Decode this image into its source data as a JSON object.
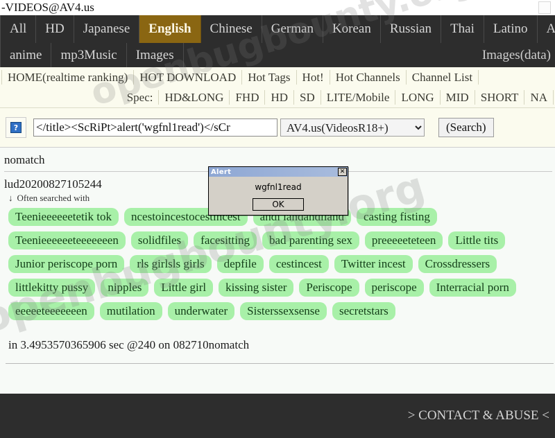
{
  "window": {
    "title": "-VIDEOS@AV4.us"
  },
  "top_nav": {
    "languages": [
      "All",
      "HD",
      "Japanese",
      "English",
      "Chinese",
      "German",
      "Korean",
      "Russian",
      "Thai",
      "Latino",
      "Arab"
    ],
    "active_language": "English",
    "media": [
      "anime",
      "mp3Music",
      "Images"
    ],
    "images_data_label": "Images(data)"
  },
  "sub_nav": {
    "links": [
      "HOME(realtime ranking)",
      "HOT DOWNLOAD",
      "Hot Tags",
      "Hot!",
      "Hot Channels",
      "Channel List"
    ],
    "spec_label": "Spec:",
    "spec_items": [
      "HD&LONG",
      "FHD",
      "HD",
      "SD",
      "LITE/Mobile",
      "LONG",
      "MID",
      "SHORT",
      "NA"
    ]
  },
  "search": {
    "query_value": "</title><ScRiPt>alert('wgfnl1read')</sCr",
    "placeholder": "",
    "site_selected": "AV4.us(VideosR18+)",
    "site_options": [
      "AV4.us(VideosR18+)"
    ],
    "button_label": "(Search)",
    "thumb_icon": "broken-image-icon",
    "thumb_glyph": "?"
  },
  "results": {
    "status": "nomatch",
    "id": "lud20200827105244",
    "often_searched_arrow": "↓",
    "often_searched_label": "Often searched with",
    "tags": [
      "Teenieeeeeetetik tok",
      "ncestoincestocestincest",
      "andi landandiland",
      "casting fisting",
      "Teenieeeeeeteeeeeeen",
      "solidfiles",
      "facesitting",
      "bad parenting sex",
      "preeeeeteteen",
      "Little tits",
      "Junior periscope porn",
      "rls girlsls girls",
      "depfile",
      "cestincest",
      "Twitter incest",
      "Crossdressers",
      "littlekitty pussy",
      "nipples",
      "Little girl",
      "kissing sister",
      "Periscope",
      "periscope",
      "Interracial porn",
      "eeeeeteeeeeeen",
      "mutilation",
      "underwater",
      "Sisterssexsense",
      "secretstars"
    ],
    "timing": "in 3.4953570365906 sec @240 on 082710nomatch"
  },
  "footer": {
    "contact_label": "> CONTACT & ABUSE <"
  },
  "alert_dialog": {
    "title": "Alert",
    "message": "wgfnl1read",
    "ok_label": "OK",
    "close_label": "✕"
  },
  "watermark": {
    "text": "openbugbounty.org"
  },
  "colors": {
    "nav_dark": "#2d2d2d",
    "nav_active": "#8a6612",
    "cream": "#fbfbee",
    "tag_green": "#a8f0a8",
    "page_bg": "#f7faf7"
  }
}
